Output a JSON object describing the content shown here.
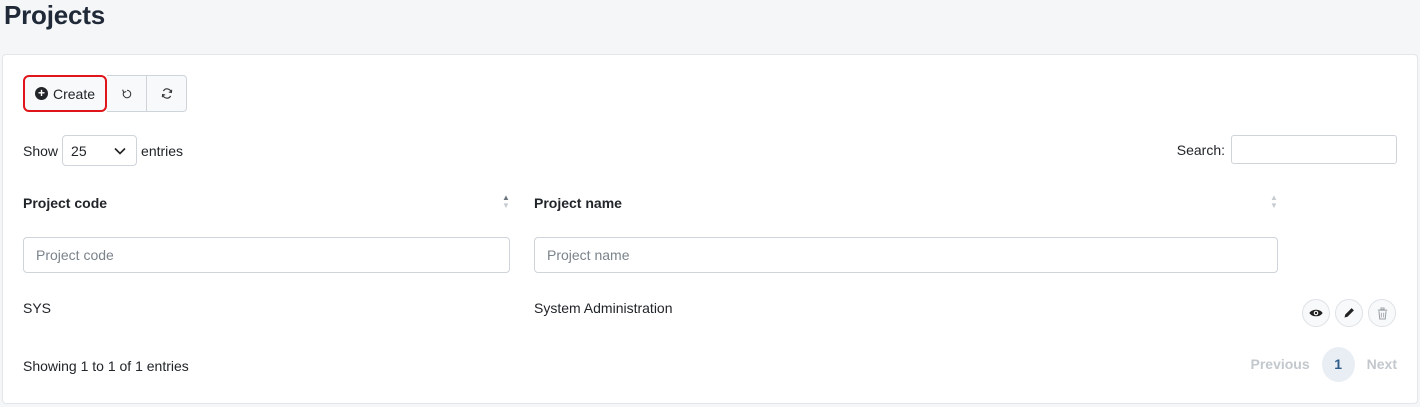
{
  "page": {
    "title": "Projects"
  },
  "toolbar": {
    "create_label": "Create",
    "buttons": [
      "undo-icon",
      "refresh-icon"
    ]
  },
  "length": {
    "prefix": "Show",
    "value": "25",
    "suffix": "entries"
  },
  "search": {
    "label": "Search:",
    "value": ""
  },
  "table": {
    "columns": [
      "Project code",
      "Project name"
    ],
    "filters": {
      "code_placeholder": "Project code",
      "name_placeholder": "Project name"
    },
    "rows": [
      {
        "code": "SYS",
        "name": "System Administration",
        "actions": [
          "eye-icon",
          "pencil-icon",
          "trash-icon"
        ]
      }
    ]
  },
  "info": "Showing 1 to 1 of 1 entries",
  "pagination": {
    "previous": "Previous",
    "current": "1",
    "next": "Next"
  },
  "colors": {
    "highlight": "#e0141b",
    "accent": "#2f5d8a"
  }
}
